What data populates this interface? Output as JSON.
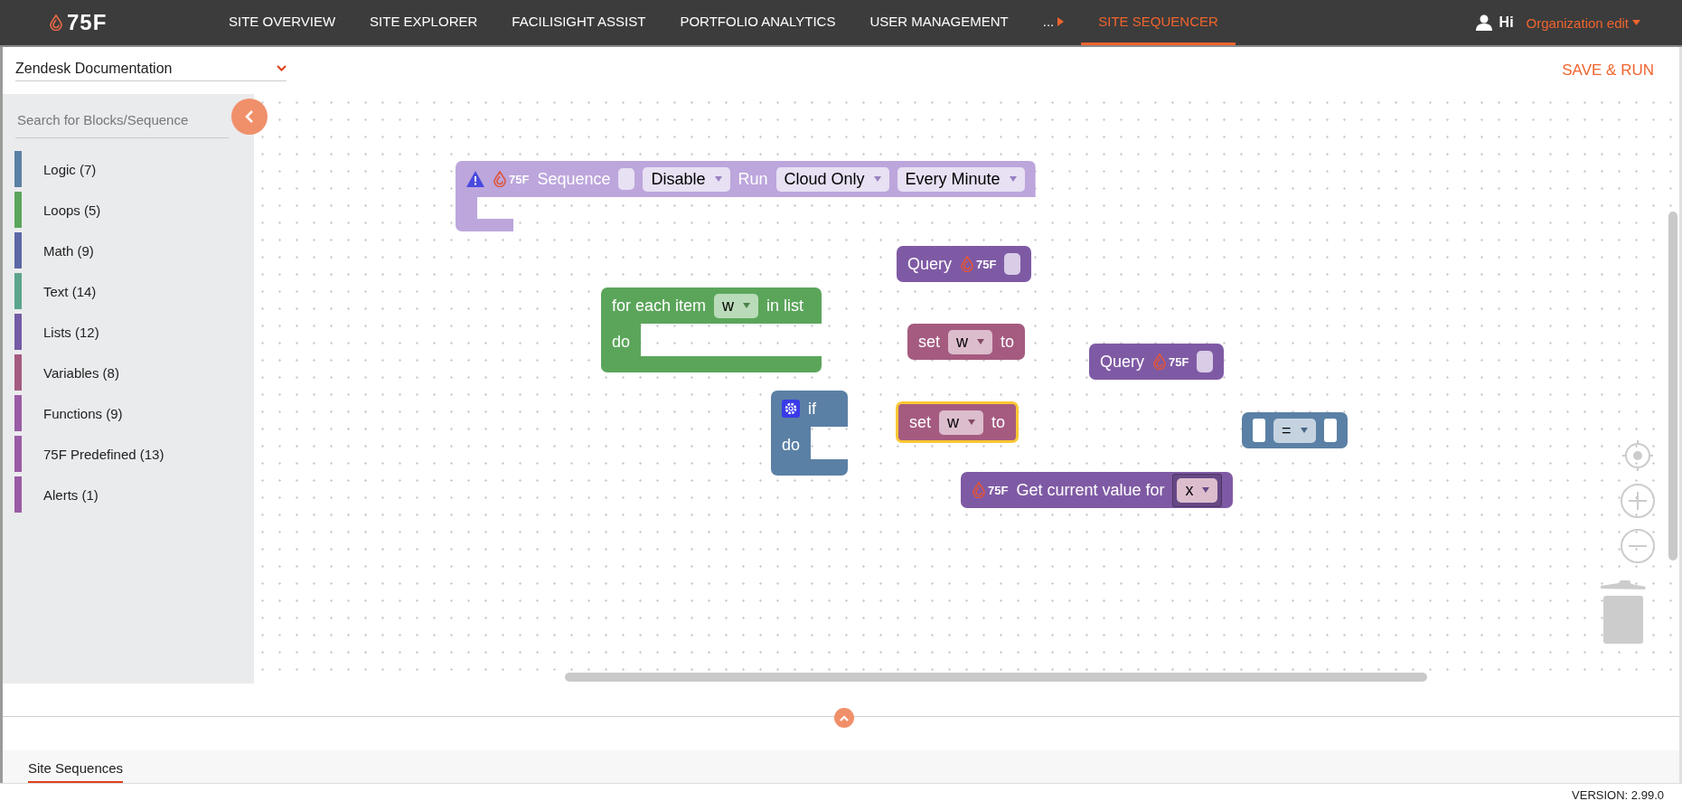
{
  "top_bar": {
    "logo": "75F",
    "nav": [
      {
        "label": "SITE OVERVIEW",
        "selected": false
      },
      {
        "label": "SITE EXPLORER",
        "selected": false
      },
      {
        "label": "FACILISIGHT ASSIST",
        "selected": false
      },
      {
        "label": "PORTFOLIO ANALYTICS",
        "selected": false
      },
      {
        "label": "USER MANAGEMENT",
        "selected": false
      },
      {
        "label": "...",
        "selected": false
      },
      {
        "label": "SITE SEQUENCER",
        "selected": true
      }
    ],
    "greeting": "Hi",
    "user": "Organization edit"
  },
  "toolbar": {
    "site_select": "Zendesk Documentation",
    "save_button": "SAVE & RUN"
  },
  "sidebar": {
    "search": {
      "placeholder": "Search for Blocks/Sequence"
    },
    "categories": [
      {
        "label": "Logic (7)",
        "color": "#5b80a5"
      },
      {
        "label": "Loops (5)",
        "color": "#5ba55b"
      },
      {
        "label": "Math (9)",
        "color": "#5b67a5"
      },
      {
        "label": "Text (14)",
        "color": "#5ba58c"
      },
      {
        "label": "Lists (12)",
        "color": "#745ba5"
      },
      {
        "label": "Variables (8)",
        "color": "#a55b80"
      },
      {
        "label": "Functions (9)",
        "color": "#995ba5"
      },
      {
        "label": "75F Predefined (13)",
        "color": "#995ba5"
      },
      {
        "label": "Alerts (1)",
        "color": "#995ba5"
      }
    ]
  },
  "blocks": [
    {
      "kind": "sequence",
      "selected": false,
      "rows": [
        [
          {
            "kind": "warning"
          },
          {
            "kind": "logo",
            "text": "75F"
          },
          {
            "kind": "label",
            "text": "Sequence"
          },
          {
            "kind": "input"
          },
          {
            "kind": "dropdown",
            "text": "Disable"
          },
          {
            "kind": "label",
            "text": "Run"
          },
          {
            "kind": "dropdown",
            "text": "Cloud Only"
          },
          {
            "kind": "dropdown",
            "text": "Every Minute"
          }
        ]
      ]
    },
    {
      "kind": "query",
      "selected": false,
      "rows": [
        [
          {
            "kind": "label",
            "text": "Query"
          },
          {
            "kind": "logo",
            "text": "75F"
          },
          {
            "kind": "input"
          }
        ]
      ]
    },
    {
      "kind": "loop",
      "selected": false,
      "rows": [
        [
          {
            "kind": "label",
            "text": "for each item"
          },
          {
            "kind": "dropdown",
            "text": "w"
          },
          {
            "kind": "label",
            "text": "in list"
          }
        ],
        [
          {
            "kind": "label",
            "text": "do"
          }
        ]
      ]
    },
    {
      "kind": "variable",
      "selected": false,
      "rows": [
        [
          {
            "kind": "label",
            "text": "set"
          },
          {
            "kind": "dropdown",
            "text": "w"
          },
          {
            "kind": "label",
            "text": "to"
          }
        ]
      ]
    },
    {
      "kind": "query",
      "selected": false,
      "rows": [
        [
          {
            "kind": "label",
            "text": "Query"
          },
          {
            "kind": "logo",
            "text": "75F"
          },
          {
            "kind": "input"
          }
        ]
      ]
    },
    {
      "kind": "logic",
      "selected": false,
      "rows": [
        [
          {
            "kind": "gear"
          },
          {
            "kind": "label",
            "text": "if"
          }
        ],
        [
          {
            "kind": "label",
            "text": "do"
          }
        ]
      ]
    },
    {
      "kind": "variable",
      "selected": true,
      "rows": [
        [
          {
            "kind": "label",
            "text": "set"
          },
          {
            "kind": "dropdown",
            "text": "w"
          },
          {
            "kind": "label",
            "text": "to"
          }
        ]
      ]
    },
    {
      "kind": "compare",
      "selected": false,
      "rows": [
        [
          {
            "kind": "socket"
          },
          {
            "kind": "dropdown",
            "text": "="
          },
          {
            "kind": "socket"
          }
        ]
      ]
    },
    {
      "kind": "function",
      "selected": false,
      "rows": [
        [
          {
            "kind": "logo",
            "text": "75F"
          },
          {
            "kind": "label",
            "text": "Get current value for"
          },
          {
            "kind": "variable",
            "text": "x"
          }
        ]
      ]
    }
  ],
  "bottom_panel": {
    "tabs": [
      {
        "label": "Site Sequences",
        "selected": true
      }
    ]
  },
  "version": "VERSION: 2.99.0"
}
